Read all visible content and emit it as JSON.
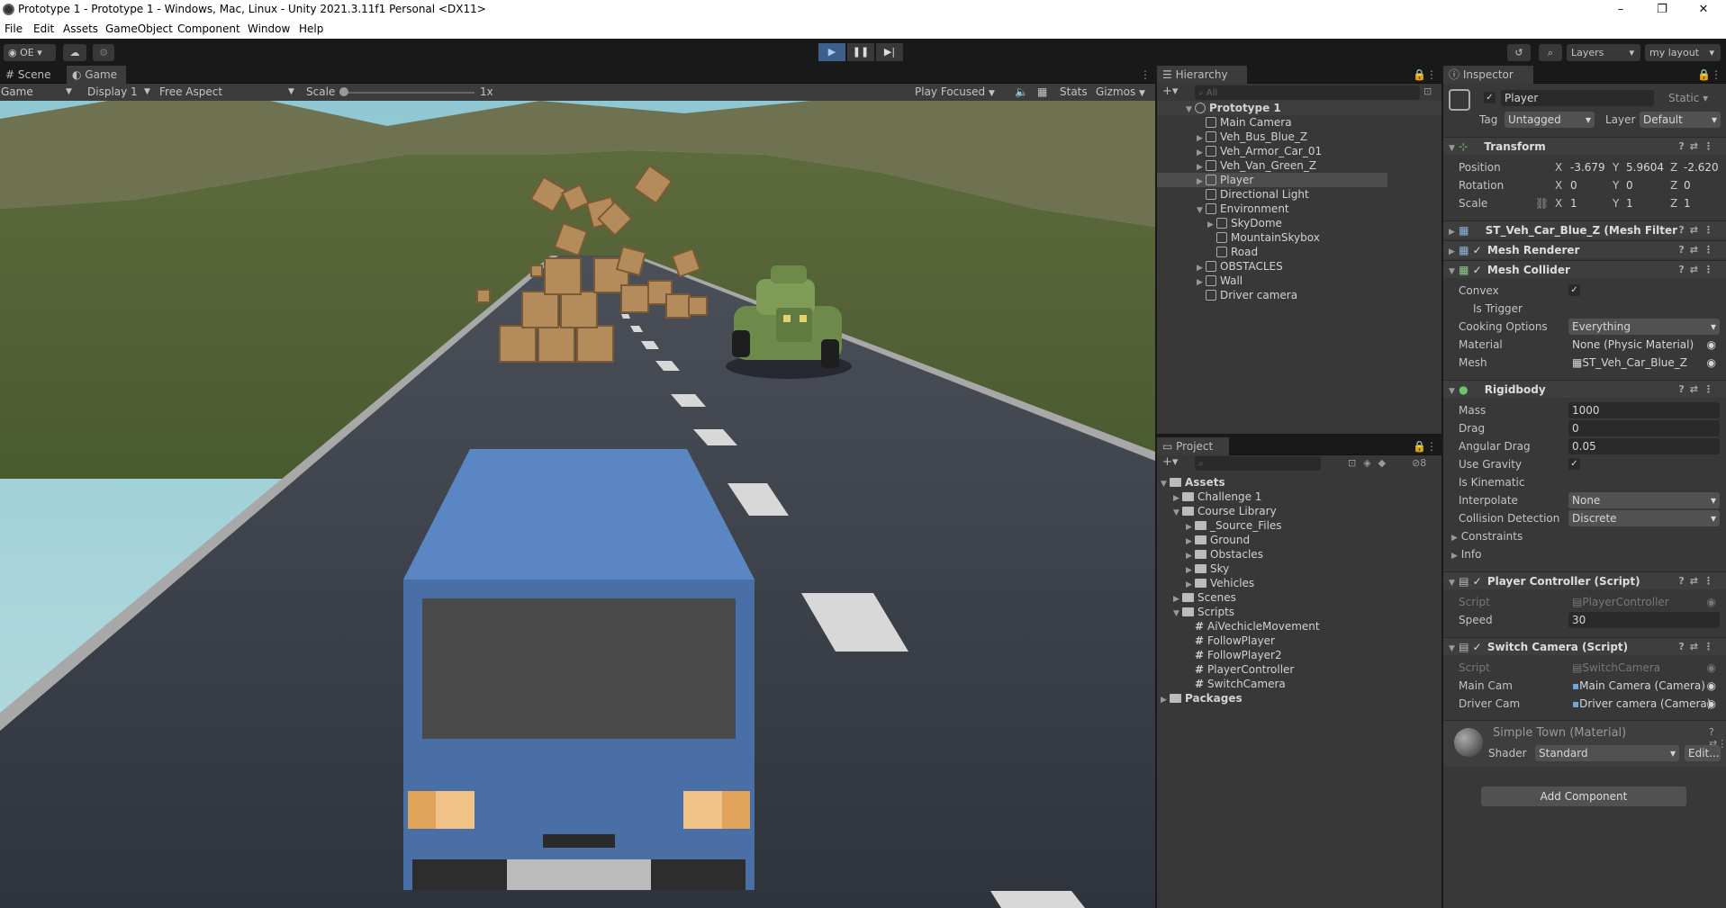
{
  "window": {
    "title": "Prototype 1 - Prototype 1 - Windows, Mac, Linux - Unity 2021.3.11f1 Personal <DX11>",
    "controls": [
      "–",
      "❐",
      "✕"
    ]
  },
  "menu": [
    "File",
    "Edit",
    "Assets",
    "GameObject",
    "Component",
    "Window",
    "Help"
  ],
  "toolbar": {
    "account": "OE",
    "layers": "Layers",
    "layout": "my layout"
  },
  "game_view": {
    "tabs": [
      "Scene",
      "Game"
    ],
    "active_tab": "Game",
    "mode": "Game",
    "display": "Display 1",
    "aspect": "Free Aspect",
    "scale_label": "Scale",
    "scale_value": "1x",
    "play_focused": "Play Focused",
    "stats": "Stats",
    "gizmos": "Gizmos"
  },
  "hierarchy": {
    "tab": "Hierarchy",
    "search_placeholder": "All",
    "scene": "Prototype 1",
    "items": [
      {
        "label": "Main Camera",
        "depth": 1,
        "arrow": ""
      },
      {
        "label": "Veh_Bus_Blue_Z",
        "depth": 1,
        "arrow": "▶"
      },
      {
        "label": "Veh_Armor_Car_01",
        "depth": 1,
        "arrow": "▶"
      },
      {
        "label": "Veh_Van_Green_Z",
        "depth": 1,
        "arrow": "▶"
      },
      {
        "label": "Player",
        "depth": 1,
        "arrow": "▶"
      },
      {
        "label": "Directional Light",
        "depth": 1,
        "arrow": ""
      },
      {
        "label": "Environment",
        "depth": 1,
        "arrow": "▼"
      },
      {
        "label": "SkyDome",
        "depth": 2,
        "arrow": "▶"
      },
      {
        "label": "MountainSkybox",
        "depth": 2,
        "arrow": ""
      },
      {
        "label": "Road",
        "depth": 2,
        "arrow": ""
      },
      {
        "label": "OBSTACLES",
        "depth": 1,
        "arrow": "▶"
      },
      {
        "label": "Wall",
        "depth": 1,
        "arrow": "▶"
      },
      {
        "label": "Driver camera",
        "depth": 1,
        "arrow": ""
      }
    ]
  },
  "project": {
    "tab": "Project",
    "hidden_count": "8",
    "items": [
      {
        "label": "Assets",
        "depth": 0,
        "arrow": "▼",
        "kind": "folder"
      },
      {
        "label": "Challenge 1",
        "depth": 1,
        "arrow": "▶",
        "kind": "folder"
      },
      {
        "label": "Course Library",
        "depth": 1,
        "arrow": "▼",
        "kind": "folder"
      },
      {
        "label": "_Source_Files",
        "depth": 2,
        "arrow": "▶",
        "kind": "folder"
      },
      {
        "label": "Ground",
        "depth": 2,
        "arrow": "▶",
        "kind": "folder"
      },
      {
        "label": "Obstacles",
        "depth": 2,
        "arrow": "▶",
        "kind": "folder"
      },
      {
        "label": "Sky",
        "depth": 2,
        "arrow": "▶",
        "kind": "folder"
      },
      {
        "label": "Vehicles",
        "depth": 2,
        "arrow": "▶",
        "kind": "folder"
      },
      {
        "label": "Scenes",
        "depth": 1,
        "arrow": "▶",
        "kind": "folder"
      },
      {
        "label": "Scripts",
        "depth": 1,
        "arrow": "▼",
        "kind": "folder"
      },
      {
        "label": "AiVechicleMovement",
        "depth": 2,
        "arrow": "",
        "kind": "script"
      },
      {
        "label": "FollowPlayer",
        "depth": 2,
        "arrow": "",
        "kind": "script"
      },
      {
        "label": "FollowPlayer2",
        "depth": 2,
        "arrow": "",
        "kind": "script"
      },
      {
        "label": "PlayerController",
        "depth": 2,
        "arrow": "",
        "kind": "script"
      },
      {
        "label": "SwitchCamera",
        "depth": 2,
        "arrow": "",
        "kind": "script"
      },
      {
        "label": "Packages",
        "depth": 0,
        "arrow": "▶",
        "kind": "folder"
      }
    ]
  },
  "inspector": {
    "tab": "Inspector",
    "object_name": "Player",
    "static": "Static",
    "tag_label": "Tag",
    "tag": "Untagged",
    "layer_label": "Layer",
    "layer": "Default",
    "transform": {
      "title": "Transform",
      "position_label": "Position",
      "position": {
        "x": "-3.679",
        "y": "5.9604",
        "z": "-2.620"
      },
      "rotation_label": "Rotation",
      "rotation": {
        "x": "0",
        "y": "0",
        "z": "0"
      },
      "scale_label": "Scale",
      "scale": {
        "x": "1",
        "y": "1",
        "z": "1"
      }
    },
    "mesh_filter": "ST_Veh_Car_Blue_Z (Mesh Filter",
    "mesh_renderer": "Mesh Renderer",
    "mesh_collider": {
      "title": "Mesh Collider",
      "convex": "Convex",
      "is_trigger": "Is Trigger",
      "cooking_label": "Cooking Options",
      "cooking": "Everything",
      "material_label": "Material",
      "material": "None (Physic Material)",
      "mesh_label": "Mesh",
      "mesh": "ST_Veh_Car_Blue_Z"
    },
    "rigidbody": {
      "title": "Rigidbody",
      "mass_label": "Mass",
      "mass": "1000",
      "drag_label": "Drag",
      "drag": "0",
      "angular_label": "Angular Drag",
      "angular": "0.05",
      "gravity_label": "Use Gravity",
      "kinematic_label": "Is Kinematic",
      "interpolate_label": "Interpolate",
      "interpolate": "None",
      "collision_label": "Collision Detection",
      "collision": "Discrete",
      "constraints": "Constraints",
      "info": "Info"
    },
    "player_controller": {
      "title": "Player Controller (Script)",
      "script_label": "Script",
      "script": "PlayerController",
      "speed_label": "Speed",
      "speed": "30"
    },
    "switch_camera": {
      "title": "Switch Camera (Script)",
      "script_label": "Script",
      "script": "SwitchCamera",
      "main_cam_label": "Main Cam",
      "main_cam": "Main Camera (Camera)",
      "driver_cam_label": "Driver Cam",
      "driver_cam": "Driver camera (Camera)"
    },
    "material": {
      "title": "Simple Town (Material)",
      "shader_label": "Shader",
      "shader": "Standard",
      "edit": "Edit..."
    },
    "add_component": "Add Component"
  },
  "colors": {
    "accent_blue": "#3a7bd5",
    "panel_bg": "#383838",
    "selected_row": "#4d4d4d"
  }
}
